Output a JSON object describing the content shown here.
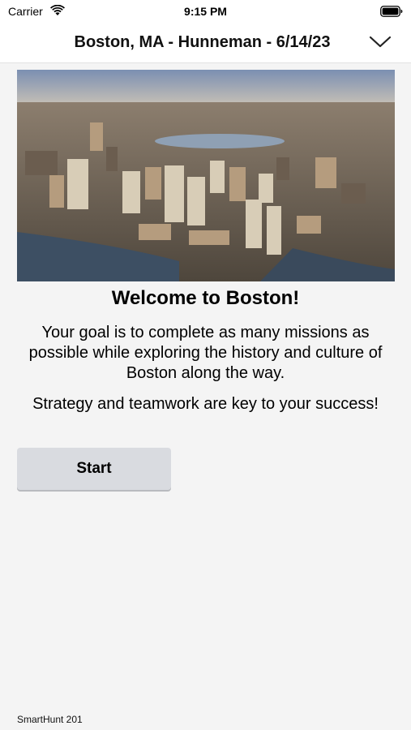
{
  "status_bar": {
    "carrier": "Carrier",
    "time": "9:15 PM",
    "icons": [
      "wifi-icon",
      "battery-icon"
    ]
  },
  "header": {
    "title": "Boston, MA - Hunneman - 6/14/23",
    "dropdown_icon": "chevron-down-icon"
  },
  "main": {
    "heading": "Welcome to Boston!",
    "goal_text": "Your goal is to complete as many missions as possible while exploring the history and culture of Boston along the way.",
    "strategy_text": "Strategy and teamwork are key to your success!",
    "start_label": "Start"
  },
  "footer": {
    "version": "SmartHunt 201"
  }
}
